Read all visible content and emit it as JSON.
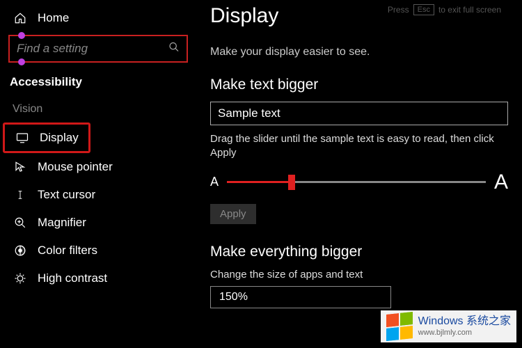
{
  "exit_fs": {
    "press": "Press",
    "key": "Esc",
    "rest": "to exit full screen"
  },
  "sidebar": {
    "home": "Home",
    "search_placeholder": "Find a setting",
    "section": "Accessibility",
    "group": "Vision",
    "items": [
      {
        "label": "Display",
        "icon": "monitor"
      },
      {
        "label": "Mouse pointer",
        "icon": "pointer"
      },
      {
        "label": "Text cursor",
        "icon": "text-cursor"
      },
      {
        "label": "Magnifier",
        "icon": "magnifier"
      },
      {
        "label": "Color filters",
        "icon": "color-filters"
      },
      {
        "label": "High contrast",
        "icon": "high-contrast"
      }
    ]
  },
  "main": {
    "title": "Display",
    "subtitle": "Make your display easier to see.",
    "text_bigger": {
      "heading": "Make text bigger",
      "sample": "Sample text",
      "instruction": "Drag the slider until the sample text is easy to read, then click Apply",
      "small_a": "A",
      "large_a": "A",
      "slider_percent": 25,
      "apply": "Apply"
    },
    "everything_bigger": {
      "heading": "Make everything bigger",
      "label": "Change the size of apps and text",
      "value": "150%"
    }
  },
  "watermark": {
    "line1": "Windows 系统之家",
    "line2": "www.bjlmly.com"
  }
}
